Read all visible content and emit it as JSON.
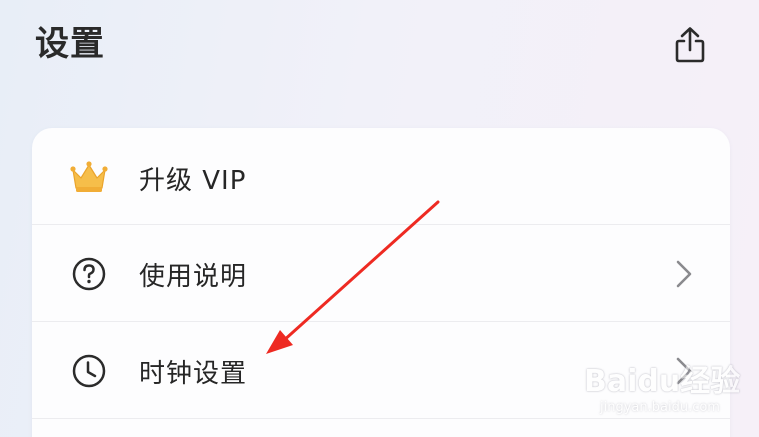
{
  "header": {
    "title": "设置",
    "share_icon": "share-icon"
  },
  "menu": {
    "items": [
      {
        "label": "升级 VIP",
        "icon": "crown-icon",
        "has_chevron": false
      },
      {
        "label": "使用说明",
        "icon": "help-circle-icon",
        "has_chevron": true
      },
      {
        "label": "时钟设置",
        "icon": "clock-icon",
        "has_chevron": true
      }
    ]
  },
  "annotation": {
    "arrow_color": "#ee2a22",
    "points_to": "时钟设置"
  },
  "watermark": {
    "brand": "Baidu经验",
    "url": "jingyan.baidu.com"
  },
  "colors": {
    "crown": "#f3b53f",
    "text": "#262626",
    "icon": "#2b2b2b",
    "chevron": "#8a8a8e"
  }
}
